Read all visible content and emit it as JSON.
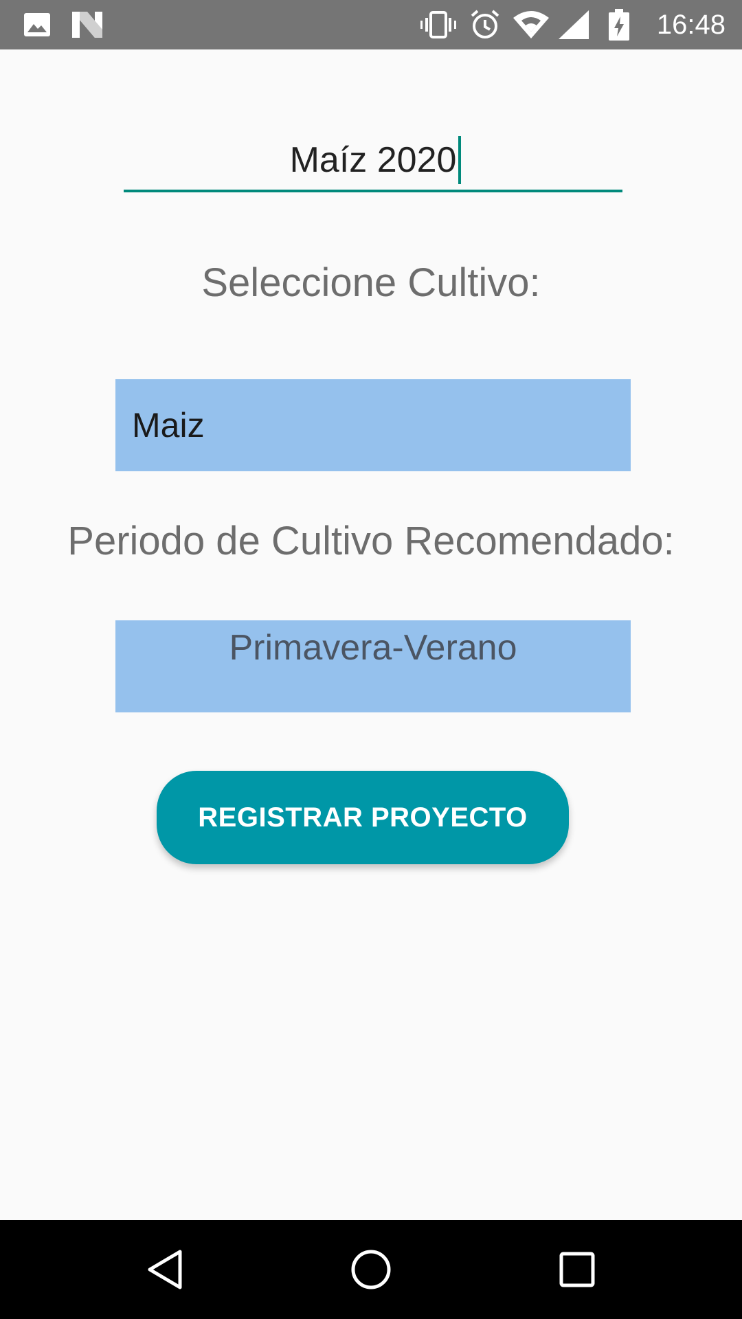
{
  "status_bar": {
    "time": "16:48",
    "left_icons": [
      "image-icon",
      "n-notification-icon"
    ],
    "right_icons": [
      "vibrate-icon",
      "alarm-icon",
      "wifi-icon",
      "signal-icon",
      "battery-charging-icon"
    ]
  },
  "form": {
    "project_name_value": "Maíz 2020",
    "select_crop_label": "Seleccione Cultivo:",
    "crop_selected": "Maiz",
    "period_label": "Periodo de Cultivo Recomendado:",
    "period_value": "Primavera-Verano",
    "register_button_label": "REGISTRAR PROYECTO"
  },
  "colors": {
    "status_bar": "#757575",
    "background": "#fafafa",
    "accent_underline": "#00897b",
    "field_bg": "#95c1ed",
    "button": "#0097a7",
    "nav_bar": "#000000"
  },
  "nav_bar": {
    "buttons": [
      "back-icon",
      "home-icon",
      "recents-icon"
    ]
  }
}
